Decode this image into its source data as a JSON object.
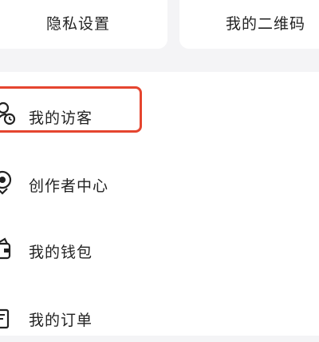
{
  "top_cards": {
    "privacy_settings": "隐私设置",
    "my_qr_code": "我的二维码"
  },
  "menu": {
    "items": [
      {
        "label": "我的访客",
        "icon": "visitors-icon"
      },
      {
        "label": "创作者中心",
        "icon": "creator-icon"
      },
      {
        "label": "我的钱包",
        "icon": "wallet-icon"
      },
      {
        "label": "我的订单",
        "icon": "orders-icon"
      }
    ]
  },
  "colors": {
    "highlight": "#e5452f",
    "background": "#f4f4f6",
    "panel": "#ffffff"
  }
}
